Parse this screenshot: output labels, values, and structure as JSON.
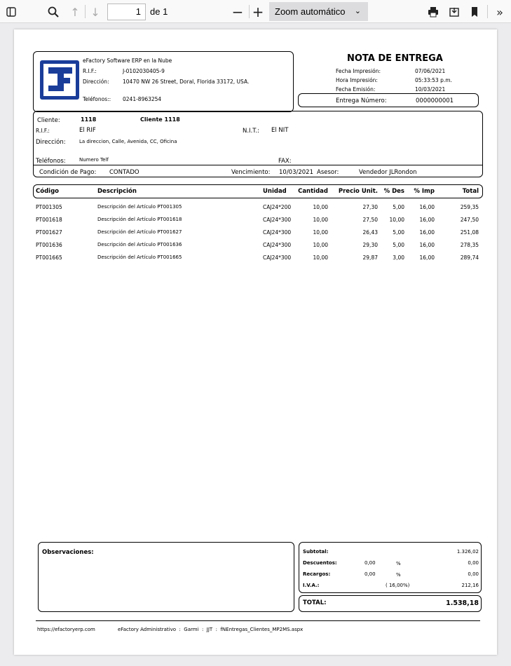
{
  "viewer": {
    "page_number": "1",
    "page_of": "de 1",
    "zoom": "Zoom automático",
    "icons": [
      "sidebar-toggle-icon",
      "search-icon",
      "arrow-up-icon",
      "arrow-down-icon",
      "minus-icon",
      "plus-icon",
      "print-icon",
      "save-icon",
      "bookmark-icon",
      "double-chevron-right-icon"
    ]
  },
  "company": {
    "name": "eFactory Software ERP en la Nube",
    "rif_label": "R.I.F.:",
    "rif": "J-0102030405-9",
    "address_label": "Dirección:",
    "address": "10470 NW 26 Street, Doral, Florida 33172, USA.",
    "phones_label": "Teléfonos::",
    "phones": "0241-8963254"
  },
  "doc": {
    "title": "NOTA DE ENTREGA",
    "print_date_label": "Fecha Impresión:",
    "print_date": "07/06/2021",
    "print_time_label": "Hora Impresión:",
    "print_time": "05:33:53 p.m.",
    "issue_date_label": "Fecha Emisión:",
    "issue_date": "10/03/2021",
    "number_label": "Entrega Número:",
    "number": "0000000001"
  },
  "client": {
    "label": "Cliente:",
    "code": "1118",
    "name": "Cliente 1118",
    "rif_label": "R.I.F.:",
    "rif": "El RIF",
    "nit_label": "N.I.T.:",
    "nit": "El NIT",
    "address_label": "Dirección:",
    "address": "La direccion, Calle, Avenida, CC, Oficina",
    "phones_label": "Teléfonos:",
    "phones": "Numero Telf",
    "fax_label": "FAX:",
    "payment_label": "Condición de Pago:",
    "payment": "CONTADO",
    "due_label": "Vencimiento:",
    "due": "10/03/2021",
    "advisor_label": "Asesor:",
    "advisor": "Vendedor JLRondon"
  },
  "table": {
    "headers": [
      "Código",
      "Descripción",
      "Unidad",
      "Cantidad",
      "Precio Unit.",
      "% Des",
      "% Imp",
      "Total"
    ],
    "rows": [
      [
        "PT001305",
        "Descripción del Artículo PT001305",
        "CAJ24*200",
        "10,00",
        "27,30",
        "5,00",
        "16,00",
        "259,35"
      ],
      [
        "PT001618",
        "Descripción del Artículo PT001618",
        "CAJ24*300",
        "10,00",
        "27,50",
        "10,00",
        "16,00",
        "247,50"
      ],
      [
        "PT001627",
        "Descripción del Artículo PT001627",
        "CAJ24*300",
        "10,00",
        "26,43",
        "5,00",
        "16,00",
        "251,08"
      ],
      [
        "PT001636",
        "Descripción del Artículo PT001636",
        "CAJ24*300",
        "10,00",
        "29,30",
        "5,00",
        "16,00",
        "278,35"
      ],
      [
        "PT001665",
        "Descripción del Artículo PT001665",
        "CAJ24*300",
        "10,00",
        "29,87",
        "3,00",
        "16,00",
        "289,74"
      ]
    ]
  },
  "observations_label": "Observaciones:",
  "totals": {
    "subtotal_label": "Subtotal:",
    "subtotal": "1.326,02",
    "discounts_label": "Descuentos:",
    "discounts_pct": "0,00",
    "discounts": "0,00",
    "charges_label": "Recargos:",
    "charges_pct": "0,00",
    "charges": "0,00",
    "pct_sign": "%",
    "iva_label": "I.V.A.:",
    "iva_pct": "( 16,00%)",
    "iva": "212,16",
    "total_label": "TOTAL:",
    "total": "1.538,18"
  },
  "footer": {
    "url": "https://efactoryerp.com",
    "info": "eFactory Administrativo  :  Garmi  :  JJT  :  fNEntregas_Clientes_MP2MS.aspx"
  }
}
